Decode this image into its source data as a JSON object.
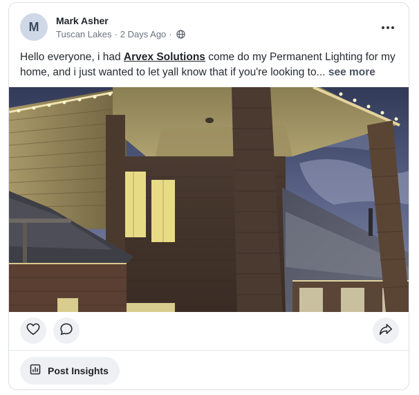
{
  "post": {
    "avatar_initial": "M",
    "author_name": "Mark Asher",
    "location": "Tuscan Lakes",
    "separator": "·",
    "time_ago": "2 Days Ago",
    "text_before": "Hello everyone, i had ",
    "mention": "Arvex Solutions",
    "text_after": " come do my Permanent Lighting for my home, and i just wanted to let yall know that if you're looking to",
    "ellipsis": "...",
    "see_more": "see more"
  },
  "actions": {
    "insights_label": "Post Insights"
  },
  "icons": {
    "visibility": "globe-icon",
    "menu": "more-horizontal-icon",
    "like": "heart-icon",
    "comment": "comment-icon",
    "share": "share-icon",
    "insights": "chart-icon"
  },
  "colors": {
    "avatar_bg": "#cfd8e6",
    "button_bg": "#eef0f3",
    "border": "#dcdfe4"
  }
}
